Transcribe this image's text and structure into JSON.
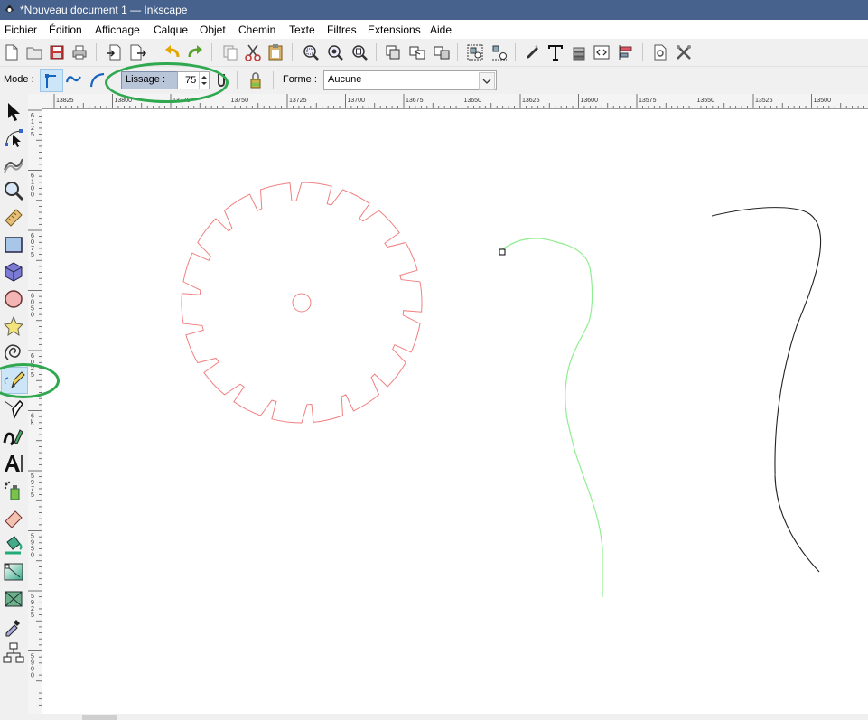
{
  "window": {
    "title": "*Nouveau document 1 — Inkscape"
  },
  "menu": [
    "Fichier",
    "Édition",
    "Affichage",
    "Calque",
    "Objet",
    "Chemin",
    "Texte",
    "Filtres",
    "Extensions",
    "Aide"
  ],
  "commands": {
    "file": [
      "new-icon",
      "open-icon",
      "save-icon",
      "print-icon"
    ],
    "io": [
      "import-icon",
      "export-icon"
    ],
    "history": [
      "undo-icon",
      "redo-icon"
    ],
    "clipboard": [
      "copy-icon",
      "cut-icon",
      "paste-icon"
    ],
    "zoom": [
      "zoom-selection-icon",
      "zoom-drawing-icon",
      "zoom-page-icon"
    ],
    "objects": [
      "duplicate-icon",
      "clone-icon",
      "unlink-clone-icon"
    ],
    "grouping": [
      "group-icon",
      "ungroup-icon"
    ],
    "dialogs": [
      "fill-stroke-icon",
      "text-font-icon",
      "layers-icon",
      "xml-editor-icon",
      "align-distribute-icon"
    ],
    "prefs": [
      "document-properties-icon",
      "preferences-icon"
    ]
  },
  "tool_controls": {
    "mode_label": "Mode :",
    "smoothing_label": "Lissage :",
    "smoothing_value": "75",
    "shape_label": "Forme :",
    "shape_value": "Aucune"
  },
  "tools": [
    "selector-icon",
    "node-editor-icon",
    "tweak-icon",
    "zoom-icon",
    "measure-icon",
    "rectangle-icon",
    "3d-box-icon",
    "ellipse-icon",
    "star-icon",
    "spiral-icon",
    "pencil-icon",
    "pen-icon",
    "calligraphy-icon",
    "text-icon",
    "spray-icon",
    "eraser-icon",
    "paint-bucket-icon",
    "gradient-icon",
    "mesh-icon",
    "dropper-icon",
    "connector-icon"
  ],
  "ruler": {
    "h_labels": [
      "13825",
      "13800",
      "13775",
      "13750",
      "13725",
      "13700",
      "13675",
      "13650",
      "13625",
      "13600",
      "13575",
      "13550",
      "13525",
      "13500"
    ],
    "v_labels": [
      "6125",
      "6100",
      "6075",
      "6050",
      "6025",
      "6k",
      "5975",
      "5950",
      "5925",
      "5900"
    ]
  },
  "colors": {
    "titlebar": "#47628c",
    "gear": "#f08080",
    "green_path": "#90ee90",
    "annotation": "#2fa84f",
    "selected_tool_bg": "#cde6f7"
  }
}
